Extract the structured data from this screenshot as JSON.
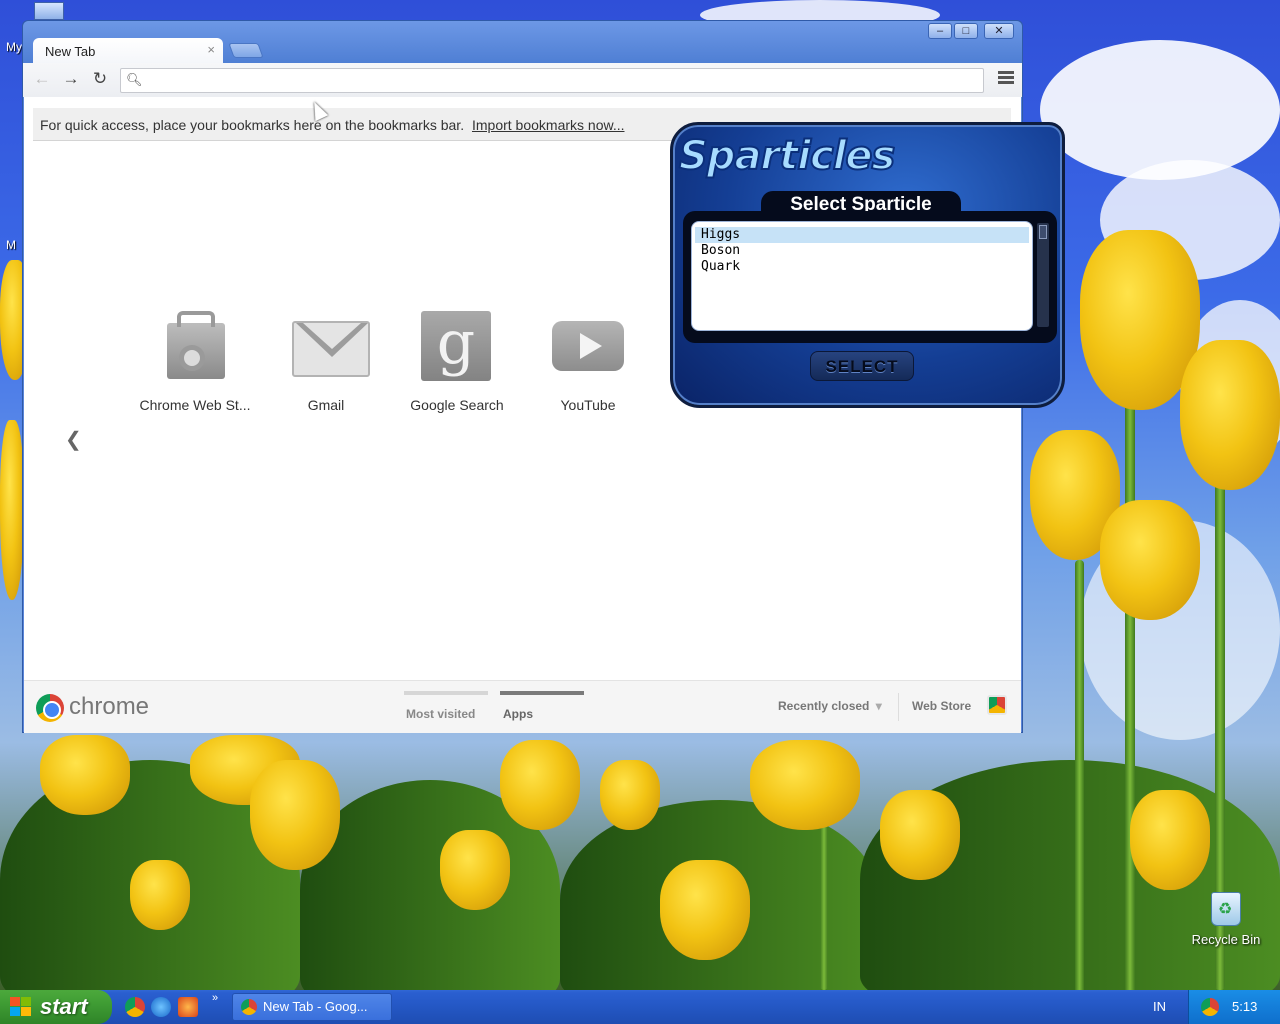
{
  "desktop": {
    "left_icon_labels": [
      "My",
      "M"
    ],
    "recycle_bin_label": "Recycle Bin"
  },
  "browser": {
    "tab_title": "New Tab",
    "tab_close": "×",
    "window_controls": [
      "–",
      "□",
      "✕"
    ],
    "omnibox_value": "",
    "bookmark_bar_text": "For quick access, place your bookmarks here on the bookmarks bar.",
    "bookmark_bar_link": "Import bookmarks now...",
    "prev_page_arrow": "❮",
    "apps": [
      {
        "label": "Chrome Web St...",
        "icon": "chrome-web-store-icon"
      },
      {
        "label": "Gmail",
        "icon": "gmail-icon"
      },
      {
        "label": "Google Search",
        "icon": "google-search-icon"
      },
      {
        "label": "YouTube",
        "icon": "youtube-icon"
      }
    ],
    "footer": {
      "logo_text": "chrome",
      "tab_most_visited": "Most visited",
      "tab_apps": "Apps",
      "recently_closed": "Recently closed",
      "recently_closed_caret": "▾",
      "web_store": "Web Store"
    }
  },
  "sparticles": {
    "logo": "Sparticles",
    "header": "Select Sparticle",
    "items": [
      "Higgs",
      "Boson",
      "Quark"
    ],
    "selected_item": "Higgs",
    "select_button": "SELECT"
  },
  "taskbar": {
    "start_label": "start",
    "quick_launch_overflow": "»",
    "task_button_label": "New Tab - Goog...",
    "language": "IN",
    "clock": "5:13"
  },
  "colors": {
    "taskbar_blue": "#2457c4",
    "start_green": "#3f9c34",
    "chrome_frame": "#5b86d8",
    "sparticles_blue": "#143e94",
    "selected_row": "#c6e2f7"
  }
}
